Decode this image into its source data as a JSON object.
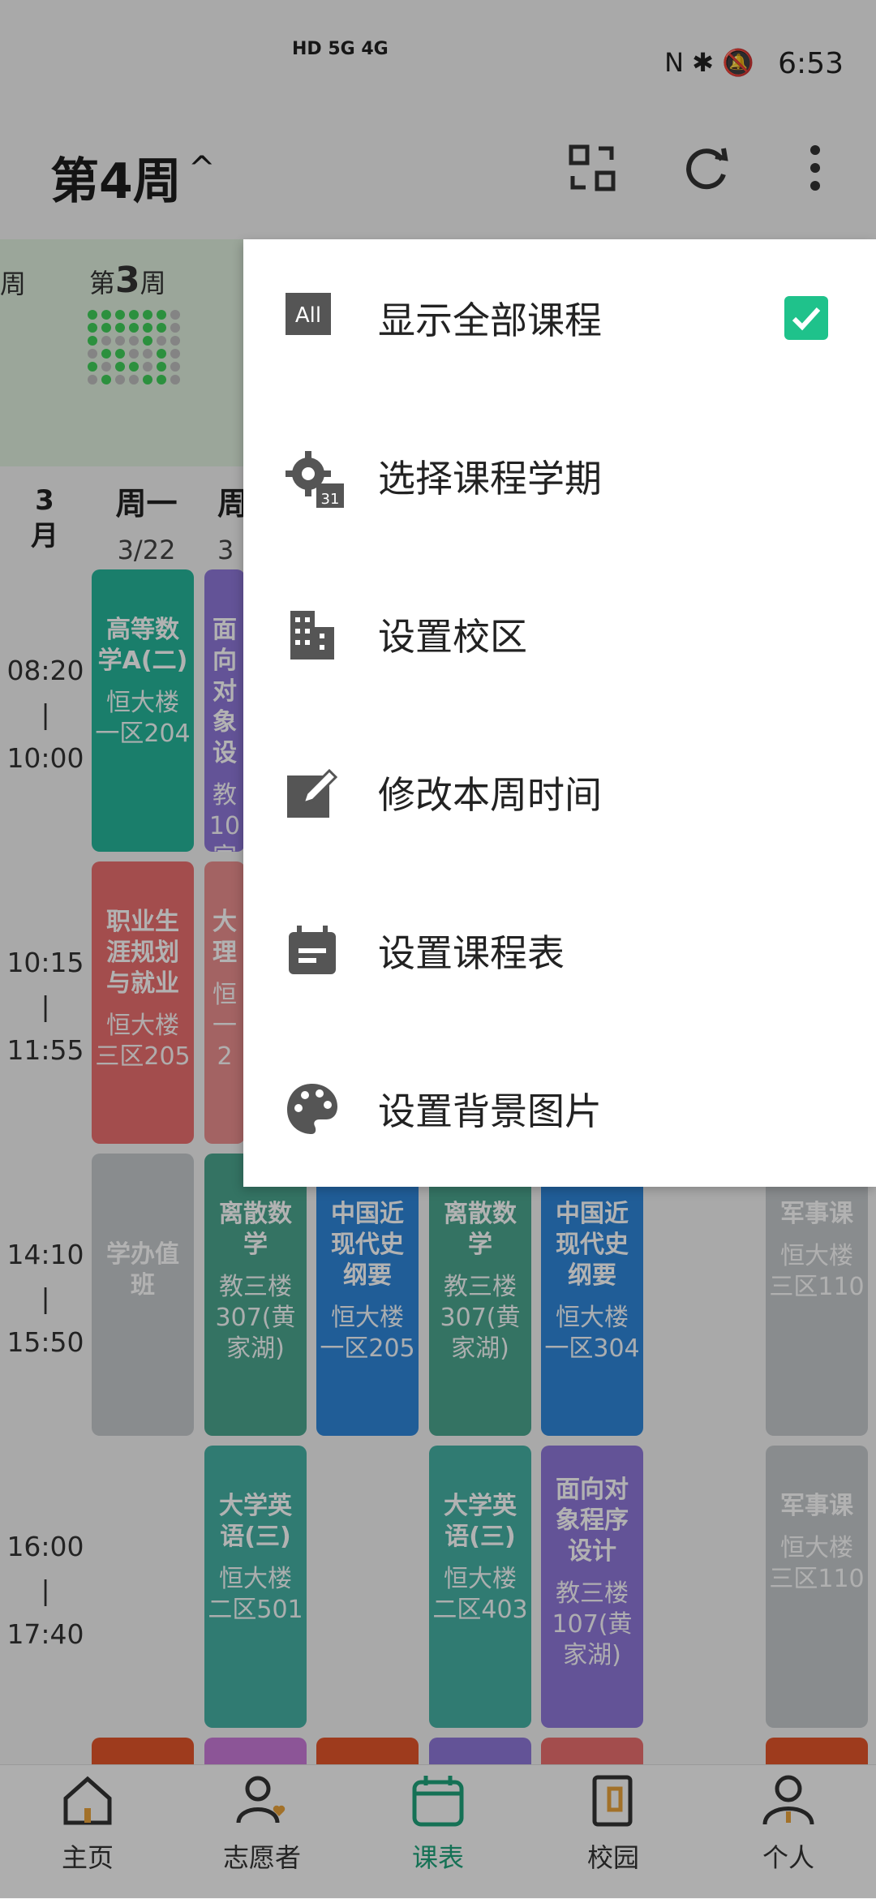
{
  "status_bar": {
    "left_info": "HD 5G 4G",
    "right_info": "N ✱ 🔕",
    "time": "6:53"
  },
  "header": {
    "week_title": "第4周",
    "caret": "^"
  },
  "week_strip": {
    "prefix": "第",
    "week": "3",
    "suffix": "周",
    "left_partial": "周"
  },
  "calendar": {
    "month": "3\n月",
    "days": [
      {
        "name": "周一",
        "date": "3/22"
      },
      {
        "name": "周",
        "date": "3"
      }
    ],
    "times": [
      "08:20\n|\n10:00",
      "10:15\n|\n11:55",
      "14:10\n|\n15:50",
      "16:00\n|\n17:40"
    ],
    "courses": [
      {
        "name": "高等数学A(二)",
        "room": "恒大楼一区204",
        "color": "#26b59a"
      },
      {
        "name": "面向对象设",
        "room": "教10家",
        "color": "#8f78d9"
      },
      {
        "name": "职业生涯规划与就业",
        "room": "恒大楼三区205",
        "color": "#ea6f6f"
      },
      {
        "name": "大理",
        "room": "恒一2",
        "color": "#ea8f8f"
      },
      {
        "name": "学办值班",
        "room": "",
        "color": "#c5c9cc"
      },
      {
        "name": "离散数学",
        "room": "教三楼307(黄家湖)",
        "color": "#4ba58f"
      },
      {
        "name": "中国近现代史纲要",
        "room": "恒大楼一区205",
        "color": "#2f86d8"
      },
      {
        "name": "离散数学",
        "room": "教三楼307(黄家湖)",
        "color": "#4ba58f"
      },
      {
        "name": "中国近现代史纲要",
        "room": "恒大楼一区304",
        "color": "#2f86d8"
      },
      {
        "name": "军事课",
        "room": "恒大楼三区110",
        "color": "#c5c9cc"
      },
      {
        "name": "大学英语(三)",
        "room": "恒大楼二区501",
        "color": "#45b0a4"
      },
      {
        "name": "大学英语(三)",
        "room": "恒大楼二区403",
        "color": "#45b0a4"
      },
      {
        "name": "面向对象程序设计",
        "room": "教三楼107(黄家湖)",
        "color": "#8f78d9"
      },
      {
        "name": "军事课",
        "room": "恒大楼三区110",
        "color": "#c5c9cc"
      }
    ]
  },
  "menu": {
    "items": [
      {
        "label": "显示全部课程",
        "icon": "all-icon",
        "checked": true
      },
      {
        "label": "选择课程学期",
        "icon": "gear-calendar-icon"
      },
      {
        "label": "设置校区",
        "icon": "building-icon"
      },
      {
        "label": "修改本周时间",
        "icon": "edit-icon"
      },
      {
        "label": "设置课程表",
        "icon": "calendar-icon"
      },
      {
        "label": "设置背景图片",
        "icon": "palette-icon"
      }
    ],
    "all_text": "All",
    "calendar_badge": "31"
  },
  "bottom_nav": {
    "items": [
      {
        "label": "主页",
        "icon": "home-icon"
      },
      {
        "label": "志愿者",
        "icon": "volunteer-icon"
      },
      {
        "label": "课表",
        "icon": "timetable-icon"
      },
      {
        "label": "校园",
        "icon": "campus-icon"
      },
      {
        "label": "个人",
        "icon": "person-icon"
      }
    ],
    "active_color": "#1fa37a"
  }
}
